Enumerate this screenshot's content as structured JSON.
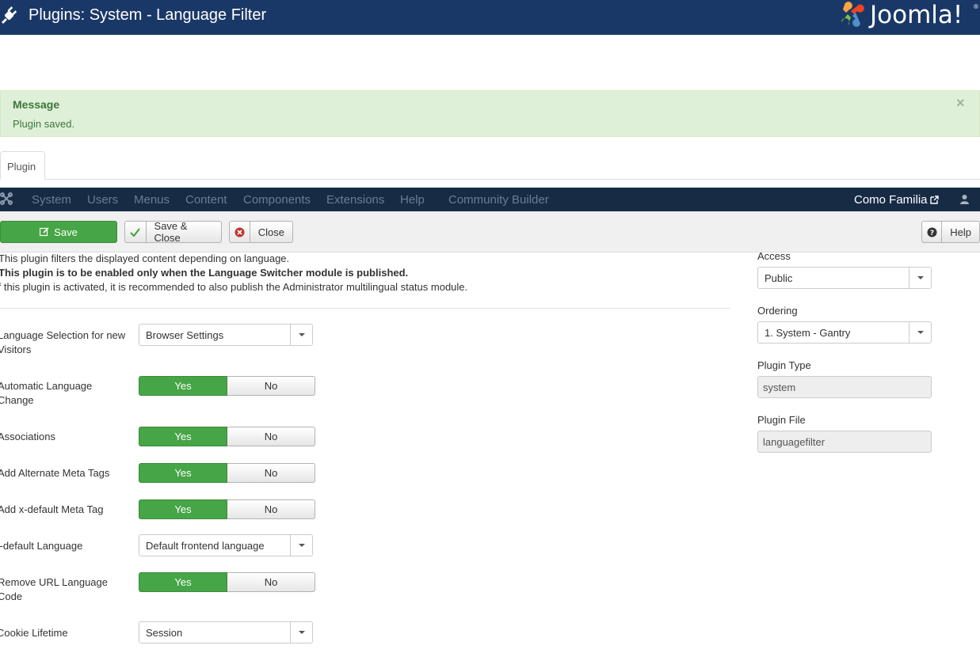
{
  "header": {
    "title": "Plugins: System - Language Filter",
    "brand": "Joomla!",
    "brand_reg": "®",
    "bg_color": "#1a3867"
  },
  "alert": {
    "heading": "Message",
    "body": "Plugin saved.",
    "close": "×"
  },
  "tabs": [
    {
      "label": "Plugin"
    }
  ],
  "nav": {
    "items": [
      "System",
      "Users",
      "Menus",
      "Content",
      "Components",
      "Extensions",
      "Help",
      "Community Builder"
    ],
    "site": "Como Familia"
  },
  "toolbar": {
    "save": "Save",
    "save_close": "Save & Close",
    "close": "Close",
    "help": "Help"
  },
  "description": {
    "line1": "This plugin filters the displayed content depending on language.",
    "line2": "This plugin is to be enabled only when the Language Switcher module is published.",
    "line3": "If this plugin is activated, it is recommended to also publish the Administrator multilingual status module."
  },
  "fields": {
    "language_selection": {
      "label": "Language Selection for new Visitors",
      "value": "Browser Settings"
    },
    "automatic_change": {
      "label": "Automatic Language Change",
      "yes": "Yes",
      "no": "No"
    },
    "associations": {
      "label": "Associations",
      "yes": "Yes",
      "no": "No"
    },
    "alternate_meta": {
      "label": "Add Alternate Meta Tags",
      "yes": "Yes",
      "no": "No"
    },
    "xdefault_meta": {
      "label": "Add x-default Meta Tag",
      "yes": "Yes",
      "no": "No"
    },
    "xdefault_language": {
      "label": "x-default Language",
      "value": "Default frontend language"
    },
    "remove_url_code": {
      "label": "Remove URL Language Code",
      "yes": "Yes",
      "no": "No"
    },
    "cookie_lifetime": {
      "label": "Cookie Lifetime",
      "value": "Session"
    }
  },
  "sidebar": {
    "access": {
      "label": "Access",
      "value": "Public"
    },
    "ordering": {
      "label": "Ordering",
      "value": "1. System - Gantry"
    },
    "plugin_type": {
      "label": "Plugin Type",
      "value": "system"
    },
    "plugin_file": {
      "label": "Plugin File",
      "value": "languagefilter"
    }
  }
}
